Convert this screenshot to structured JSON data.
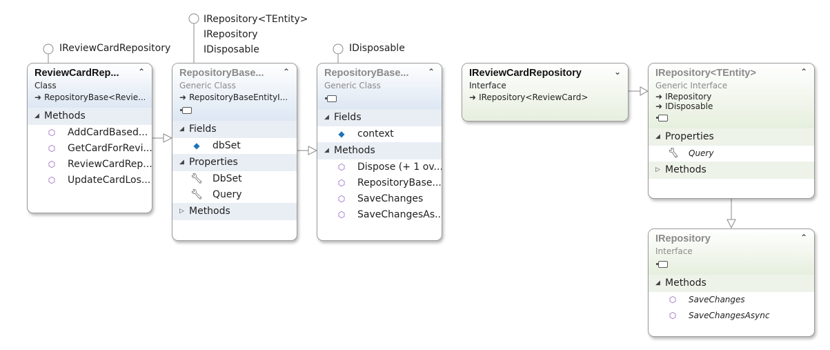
{
  "lollipops": {
    "reviewcard": "IReviewCardRepository",
    "repobase1": [
      "IRepository<TEntity>",
      "IRepository",
      "IDisposable"
    ],
    "repobase2": "IDisposable"
  },
  "boxes": {
    "reviewcard_repo": {
      "title": "ReviewCardRep...",
      "kind": "Class",
      "inherits": "RepositoryBase<Revie...",
      "methods_label": "Methods",
      "methods": [
        "AddCardBased...",
        "GetCardForRevi...",
        "ReviewCardRep...",
        "UpdateCardLos..."
      ]
    },
    "repobase_entity": {
      "title": "RepositoryBase...",
      "kind": "Generic Class",
      "inherits": "RepositoryBaseEntityI...",
      "fields_label": "Fields",
      "fields": [
        "dbSet"
      ],
      "properties_label": "Properties",
      "properties": [
        "DbSet",
        "Query"
      ],
      "methods_label": "Methods"
    },
    "repobase": {
      "title": "RepositoryBase...",
      "kind": "Generic Class",
      "fields_label": "Fields",
      "fields": [
        "context"
      ],
      "methods_label": "Methods",
      "methods": [
        "Dispose (+ 1 ov...",
        "RepositoryBase...",
        "SaveChanges",
        "SaveChangesAs..."
      ]
    },
    "ireviewcard_repo": {
      "title": "IReviewCardRepository",
      "kind": "Interface",
      "inherits": "IRepository<ReviewCard>"
    },
    "irepository_tentity": {
      "title": "IRepository<TEntity>",
      "kind": "Generic Interface",
      "inherits": [
        "IRepository",
        "IDisposable"
      ],
      "properties_label": "Properties",
      "properties": [
        "Query"
      ],
      "methods_label": "Methods"
    },
    "irepository": {
      "title": "IRepository",
      "kind": "Interface",
      "methods_label": "Methods",
      "methods": [
        "SaveChanges",
        "SaveChangesAsync"
      ]
    }
  },
  "icons": {
    "method": "purple-cube-icon",
    "field": "blue-field-icon",
    "property": "wrench-icon",
    "expanded": "triangle-down-icon",
    "collapsed": "triangle-right-icon",
    "collapse": "double-chevron-up-icon",
    "expand": "double-chevron-down-icon"
  },
  "colors": {
    "class_header": "#dde7f3",
    "interface_header": "#e6efde",
    "method_icon": "#8b4fb8",
    "field_icon": "#1f72b8"
  }
}
